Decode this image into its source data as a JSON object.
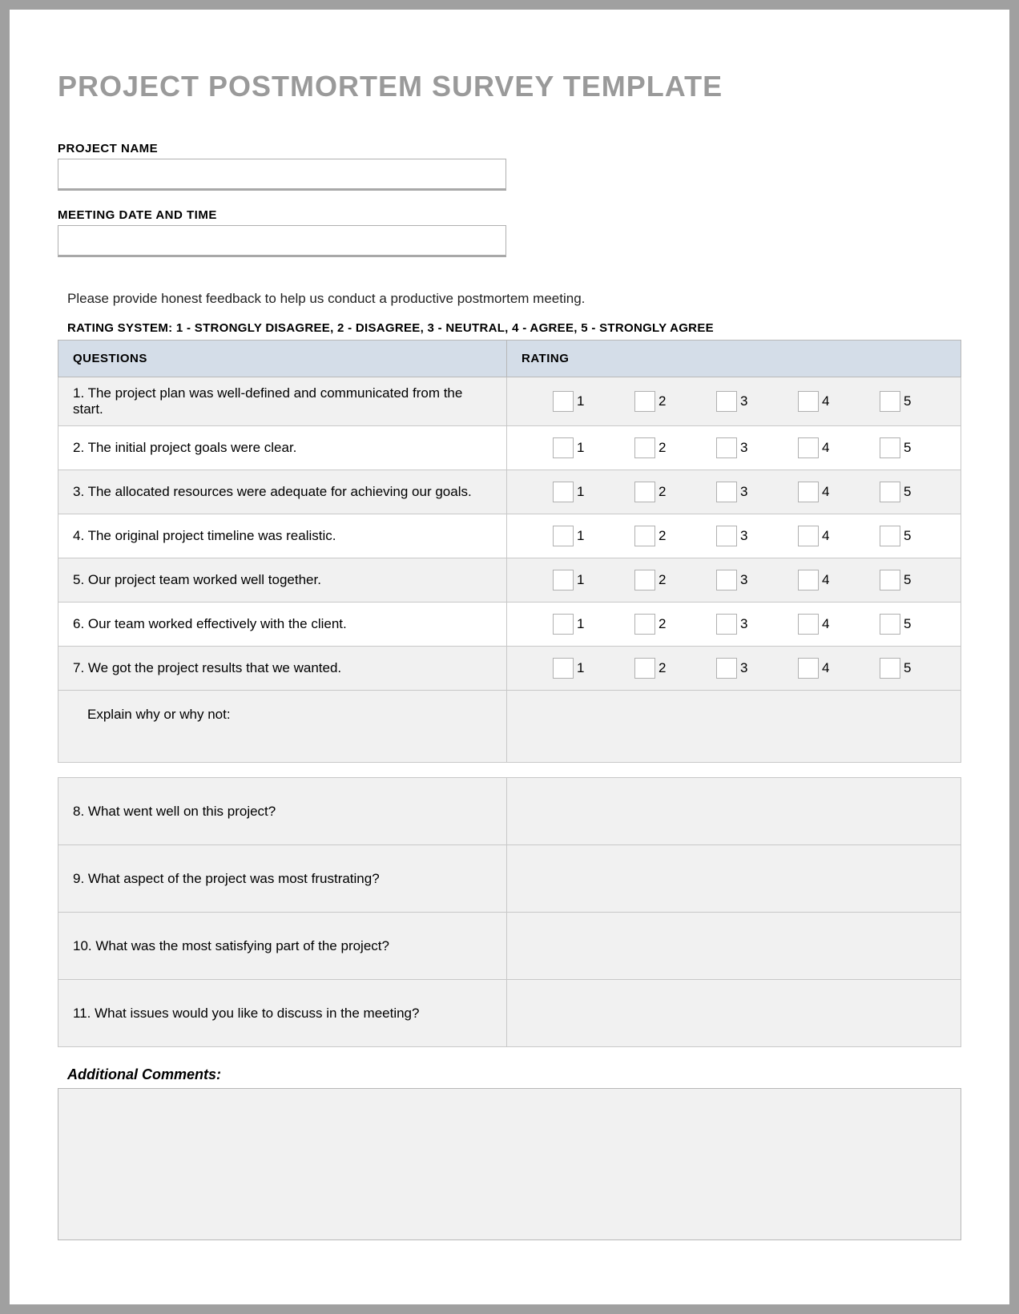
{
  "title": "PROJECT POSTMORTEM SURVEY TEMPLATE",
  "fields": {
    "project_name": {
      "label": "PROJECT NAME",
      "value": ""
    },
    "meeting_datetime": {
      "label": "MEETING DATE AND TIME",
      "value": ""
    }
  },
  "instructions": "Please provide honest feedback to help us conduct a productive postmortem meeting.",
  "rating_system": "RATING SYSTEM: 1 - STRONGLY DISAGREE, 2 - DISAGREE, 3 - NEUTRAL, 4 - AGREE, 5 - STRONGLY AGREE",
  "headers": {
    "questions": "QUESTIONS",
    "rating": "RATING"
  },
  "rating_labels": [
    "1",
    "2",
    "3",
    "4",
    "5"
  ],
  "questions": [
    "1. The project plan was well-defined and communicated from the start.",
    "2. The initial project goals were clear.",
    "3. The allocated resources were adequate for achieving our goals.",
    "4. The original project timeline was realistic.",
    "5. Our project team worked well together.",
    "6. Our team worked effectively with the client.",
    "7. We got the project results that we wanted."
  ],
  "explain_label": "Explain why or why not:",
  "open_questions": [
    "8. What went well on this project?",
    "9. What aspect of the project was most frustrating?",
    "10. What was the most satisfying part of the project?",
    "11. What issues would you like to discuss in the meeting?"
  ],
  "comments_label": "Additional Comments:"
}
